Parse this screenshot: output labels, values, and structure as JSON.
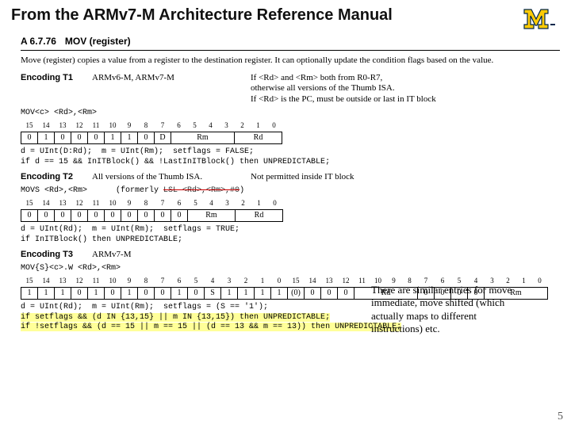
{
  "title": "From the ARMv7-M Architecture Reference Manual",
  "section": {
    "code": "A 6.7.76",
    "name": "MOV (register)"
  },
  "description": "Move (register) copies a value from a register to the destination register. It can optionally update the condition flags based on the value.",
  "enc1": {
    "label": "Encoding T1",
    "arch": "ARMv6-M, ARMv7-M",
    "note1": "If <Rd> and <Rm> both from R0-R7,",
    "note2": "otherwise all versions of the Thumb ISA.",
    "note3": "If <Rd> is the PC, must be outside or last in IT block",
    "syntax": "MOV<c>  <Rd>,<Rm>",
    "bits_header": [
      "15",
      "14",
      "13",
      "12",
      "11",
      "10",
      "9",
      "8",
      "7",
      "6",
      "5",
      "4",
      "3",
      "2",
      "1",
      "0"
    ],
    "bits_row": [
      "0",
      "1",
      "0",
      "0",
      "0",
      "1",
      "1",
      "0",
      "D",
      "Rm",
      "Rd"
    ],
    "pseudo1": "d = UInt(D:Rd);  m = UInt(Rm);  setflags = FALSE;",
    "pseudo2": "if d == 15 && InITBlock() && !LastInITBlock() then UNPREDICTABLE;"
  },
  "enc2": {
    "label": "Encoding T2",
    "arch": "All versions of the Thumb ISA.",
    "right": "Not permitted inside IT block",
    "syntax": "MOVS  <Rd>,<Rm>",
    "formerly_pre": "(formerly ",
    "formerly_struck": "LSL  <Rd>,<Rm>,#0",
    "formerly_post": ")",
    "bits_header": [
      "15",
      "14",
      "13",
      "12",
      "11",
      "10",
      "9",
      "8",
      "7",
      "6",
      "5",
      "4",
      "3",
      "2",
      "1",
      "0"
    ],
    "bits_row": [
      "0",
      "0",
      "0",
      "0",
      "0",
      "0",
      "0",
      "0",
      "0",
      "0",
      "Rm",
      "Rd"
    ],
    "pseudo1": "d = UInt(Rd);  m = UInt(Rm);  setflags = TRUE;",
    "pseudo2": "if InITBlock() then UNPREDICTABLE;"
  },
  "enc3": {
    "label": "Encoding T3",
    "arch": "ARMv7-M",
    "syntax": "MOV{S}<c>.W  <Rd>,<Rm>",
    "bits_header": [
      "15",
      "14",
      "13",
      "12",
      "11",
      "10",
      "9",
      "8",
      "7",
      "6",
      "5",
      "4",
      "3",
      "2",
      "1",
      "0",
      "15",
      "14",
      "13",
      "12",
      "11",
      "10",
      "9",
      "8",
      "7",
      "6",
      "5",
      "4",
      "3",
      "2",
      "1",
      "0"
    ],
    "bits_row": [
      "1",
      "1",
      "1",
      "0",
      "1",
      "0",
      "1",
      "0",
      "0",
      "1",
      "0",
      "S",
      "1",
      "1",
      "1",
      "1",
      "(0)",
      "0",
      "0",
      "0",
      "Rd",
      "0",
      "0",
      "0",
      "0",
      "Rm"
    ],
    "pseudo1": "d = UInt(Rd);  m = UInt(Rm);  setflags = (S == '1');",
    "pseudo2": "if setflags && (d IN {13,15} || m IN {13,15}) then UNPREDICTABLE;",
    "pseudo3": "if !setflags && (d == 15 || m == 15 || (d == 13 && m == 13)) then UNPREDICTABLE;"
  },
  "annotation": "There are similar entries for move immediate, move shifted (which actually maps to different instructions) etc.",
  "slide_number": "5"
}
